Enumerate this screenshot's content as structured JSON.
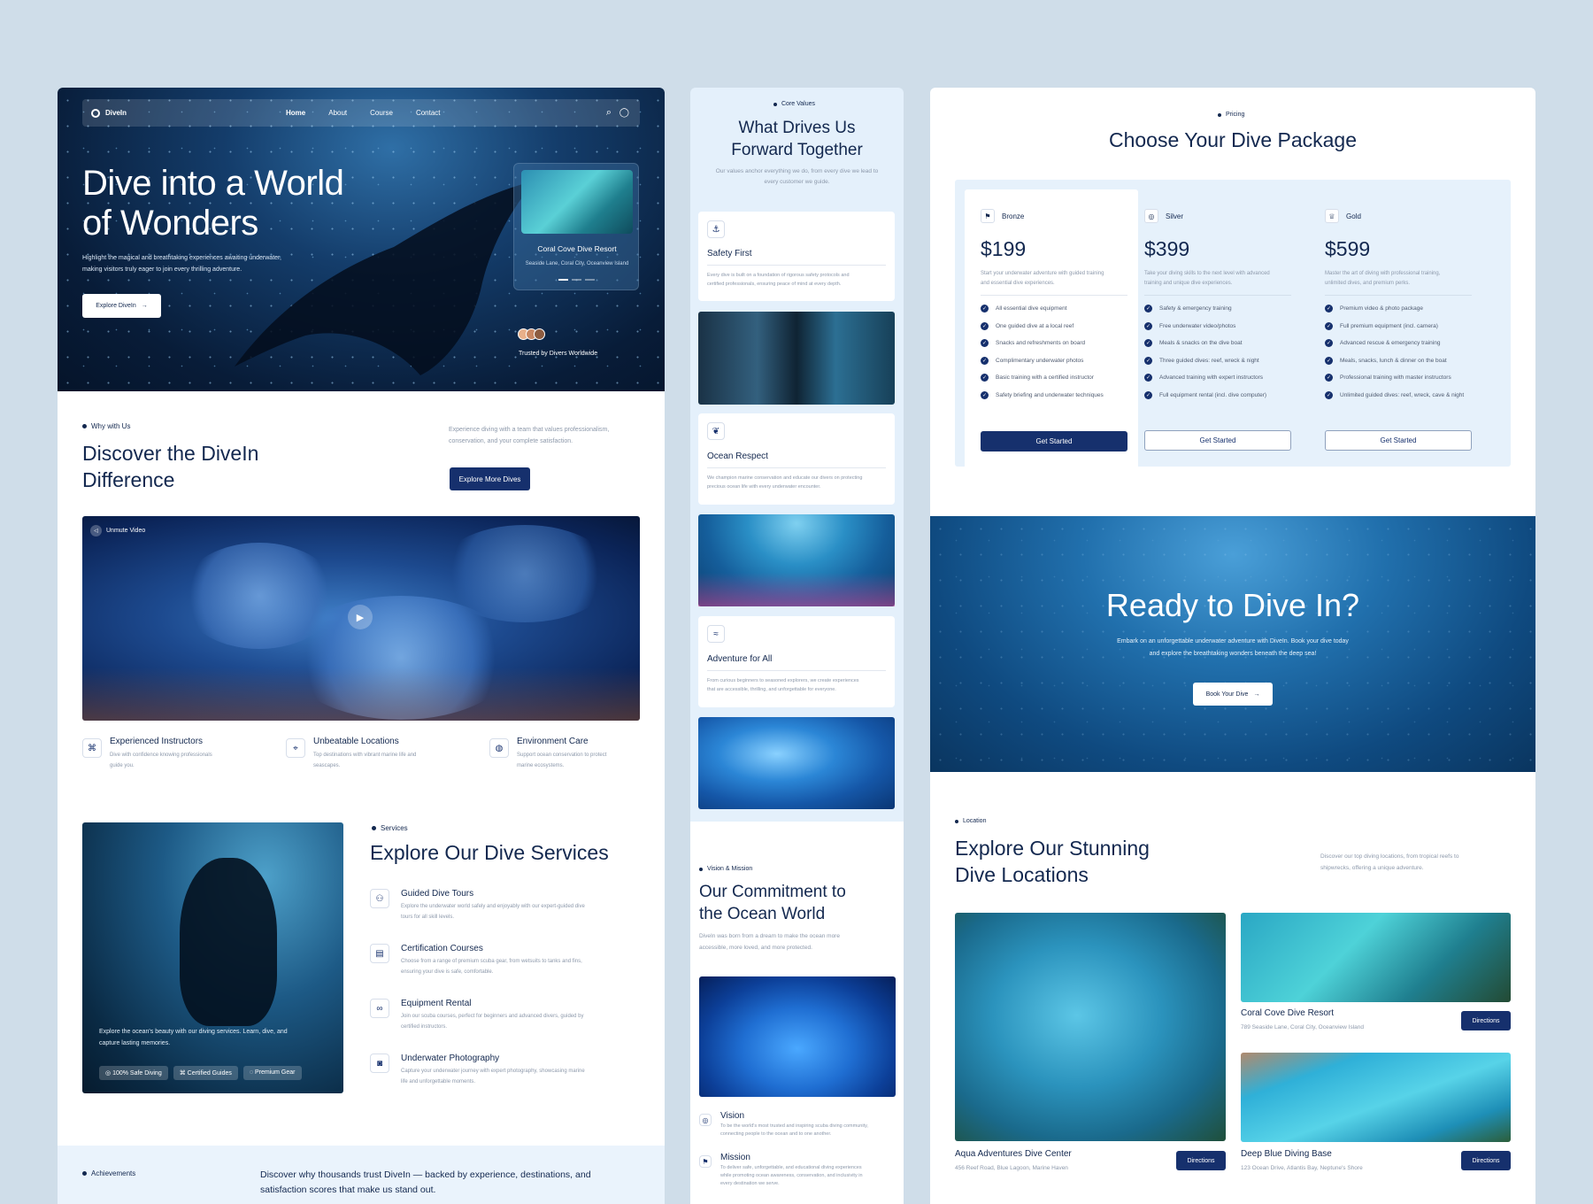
{
  "left": {
    "nav": {
      "brand": "DiveIn",
      "links": [
        "Home",
        "About",
        "Course",
        "Contact"
      ]
    },
    "hero": {
      "title_line1": "Dive into a World",
      "title_line2": "of Wonders",
      "desc_line1": "Highlight the magical and breathtaking experiences awaiting underwater,",
      "desc_line2": "making visitors truly eager to join every thrilling adventure.",
      "cta": "Explore DiveIn",
      "card_title": "Coral Cove Dive Resort",
      "card_sub": "Seaside Lane, Coral City, Oceanview Island",
      "trusted": "Trusted by Divers Worldwide"
    },
    "why": {
      "tag": "Why with Us",
      "title_line1": "Discover the DiveIn",
      "title_line2": "Difference",
      "desc_line1": "Experience diving with a team that values professionalism,",
      "desc_line2": "conservation, and your complete satisfaction.",
      "cta": "Explore More Dives",
      "video_label": "Unmute Video",
      "features": [
        {
          "title": "Experienced Instructors",
          "desc_line1": "Dive with confidence knowing professionals",
          "desc_line2": "guide you."
        },
        {
          "title": "Unbeatable Locations",
          "desc_line1": "Top destinations with vibrant marine life and",
          "desc_line2": "seascapes."
        },
        {
          "title": "Environment Care",
          "desc_line1": "Support ocean conservation to protect",
          "desc_line2": "marine ecosystems."
        }
      ]
    },
    "services": {
      "tag": "Services",
      "title": "Explore Our Dive Services",
      "photo_caption_line1": "Explore the ocean's beauty with our diving services. Learn, dive, and",
      "photo_caption_line2": "capture lasting memories.",
      "badges": [
        "100% Safe Diving",
        "Certified Guides",
        "Premium Gear"
      ],
      "items": [
        {
          "title": "Guided Dive Tours",
          "desc_line1": "Explore the underwater world safely and enjoyably with our expert-guided dive",
          "desc_line2": "tours for all skill levels."
        },
        {
          "title": "Certification Courses",
          "desc_line1": "Choose from a range of premium scuba gear, from wetsuits to tanks and fins,",
          "desc_line2": "ensuring your dive is safe, comfortable."
        },
        {
          "title": "Equipment Rental",
          "desc_line1": "Join our scuba courses, perfect for beginners and advanced divers, guided by",
          "desc_line2": "certified instructors."
        },
        {
          "title": "Underwater Photography",
          "desc_line1": "Capture your underwater journey with expert photography, showcasing marine",
          "desc_line2": "life and unforgettable moments."
        }
      ]
    },
    "achievements": {
      "tag": "Achievements",
      "text_line1": "Discover why thousands trust DiveIn — backed by experience, destinations, and",
      "text_line2": "satisfaction scores that make us stand out."
    }
  },
  "mid": {
    "tag": "Core Values",
    "title_line1": "What Drives Us",
    "title_line2": "Forward Together",
    "desc_line1": "Our values anchor everything we do, from every dive we lead to",
    "desc_line2": "every customer we guide.",
    "values": [
      {
        "title": "Safety First",
        "desc_line1": "Every dive is built on a foundation of rigorous safety protocols and",
        "desc_line2": "certified professionals, ensuring peace of mind at every depth."
      },
      {
        "title": "Ocean Respect",
        "desc_line1": "We champion marine conservation and educate our divers on protecting",
        "desc_line2": "precious ocean life with every underwater encounter."
      },
      {
        "title": "Adventure for All",
        "desc_line1": "From curious beginners to seasoned explorers, we create experiences",
        "desc_line2": "that are accessible, thrilling, and unforgettable for everyone."
      }
    ],
    "vision_tag": "Vision & Mission",
    "vision_title_line1": "Our Commitment to",
    "vision_title_line2": "the Ocean World",
    "vision_desc_line1": "DiveIn was born from a dream to make the ocean more",
    "vision_desc_line2": "accessible, more loved, and more protected.",
    "vision": {
      "title": "Vision",
      "desc_line1": "To be the world's most trusted and inspiring scuba diving community,",
      "desc_line2": "connecting people to the ocean and to one another."
    },
    "mission": {
      "title": "Mission",
      "desc_line1": "To deliver safe, unforgettable, and educational diving experiences",
      "desc_line2": "while promoting ocean awareness, conservation, and inclusivity in",
      "desc_line3": "every destination we serve."
    }
  },
  "right": {
    "pricing_tag": "Pricing",
    "pricing_title": "Choose Your Dive Package",
    "plans": [
      {
        "name": "Bronze",
        "price": "$199",
        "desc_line1": "Start your underwater adventure with guided training",
        "desc_line2": "and essential dive experiences.",
        "cta": "Get Started",
        "features": [
          "All essential dive equipment",
          "One guided dive at a local reef",
          "Snacks and refreshments on board",
          "Complimentary underwater photos",
          "Basic training with a certified instructor",
          "Safety briefing and underwater techniques"
        ]
      },
      {
        "name": "Silver",
        "price": "$399",
        "desc_line1": "Take your diving skills to the next level with advanced",
        "desc_line2": "training and unique dive experiences.",
        "cta": "Get Started",
        "features": [
          "Safety & emergency training",
          "Free underwater video/photos",
          "Meals & snacks on the dive boat",
          "Three guided dives: reef, wreck & night",
          "Advanced training with expert instructors",
          "Full equipment rental (incl. dive computer)"
        ]
      },
      {
        "name": "Gold",
        "price": "$599",
        "desc_line1": "Master the art of diving with professional training,",
        "desc_line2": "unlimited dives, and premium perks.",
        "cta": "Get Started",
        "features": [
          "Premium video & photo package",
          "Full premium equipment (incl. camera)",
          "Advanced rescue & emergency training",
          "Meals, snacks, lunch & dinner on the boat",
          "Professional training with master instructors",
          "Unlimited guided dives: reef, wreck, cave & night"
        ]
      }
    ],
    "cta_section": {
      "title": "Ready to Dive In?",
      "desc_line1": "Embark on an unforgettable underwater adventure with DiveIn. Book your dive today",
      "desc_line2": "and explore the breathtaking wonders beneath the deep sea!",
      "button": "Book Your Dive"
    },
    "location": {
      "tag": "Location",
      "title_line1": "Explore Our Stunning",
      "title_line2": "Dive Locations",
      "desc_line1": "Discover our top diving locations, from tropical reefs to",
      "desc_line2": "shipwrecks, offering a unique adventure.",
      "places": [
        {
          "name": "Aqua Adventures Dive Center",
          "address": "456 Reef Road, Blue Lagoon, Marine Haven",
          "cta": "Directions"
        },
        {
          "name": "Coral Cove Dive Resort",
          "address": "789 Seaside Lane, Coral City, Oceanview Island",
          "cta": "Directions"
        },
        {
          "name": "Deep Blue Diving Base",
          "address": "123 Ocean Drive, Atlantis Bay, Neptune's Shore",
          "cta": "Directions"
        }
      ]
    }
  }
}
